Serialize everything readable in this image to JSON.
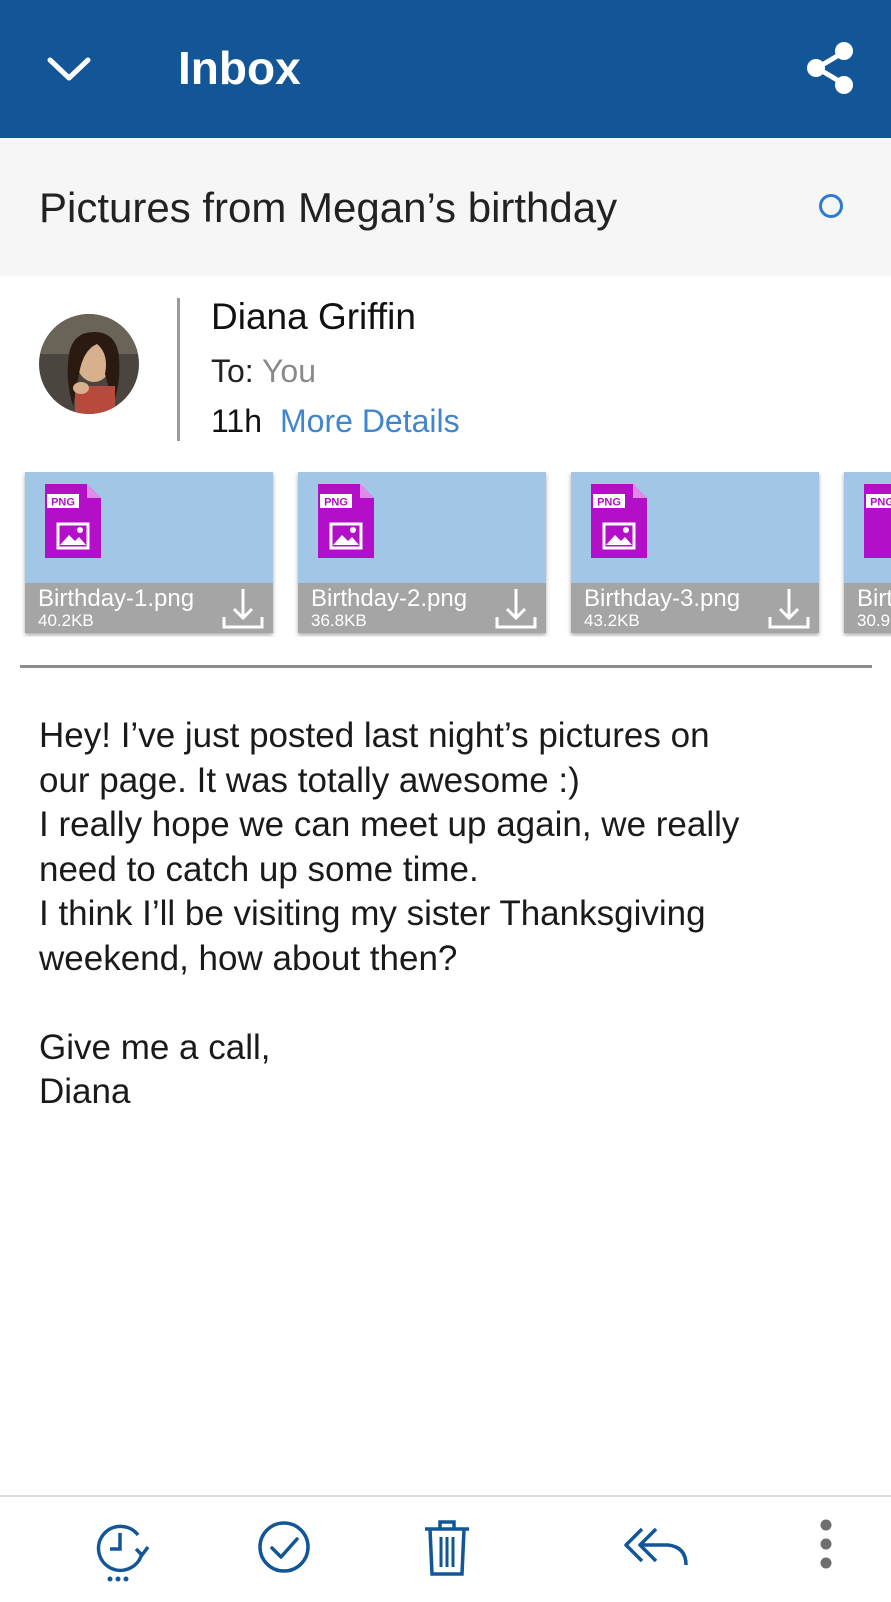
{
  "header": {
    "title": "Inbox",
    "back_icon": "chevron-down-icon",
    "share_icon": "share-icon",
    "bg_color": "#135697"
  },
  "message": {
    "subject": "Pictures from Megan’s birthday",
    "unread_indicator": "circle-outline-icon",
    "sender": "Diana Griffin",
    "to_label": "To:",
    "to_value": "You",
    "time": "11h",
    "more_details": "More Details"
  },
  "attachments": [
    {
      "name": "Birthday-1.png",
      "size": "40.2KB",
      "type_badge": "PNG"
    },
    {
      "name": "Birthday-2.png",
      "size": "36.8KB",
      "type_badge": "PNG"
    },
    {
      "name": "Birthday-3.png",
      "size": "43.2KB",
      "type_badge": "PNG"
    },
    {
      "name": "Birt",
      "size": "30.9",
      "type_badge": "PNG"
    }
  ],
  "body": "Hey! I’ve just posted last night’s pictures on\nour page. It was totally awesome :)\nI really hope we can meet up again, we really\nneed to catch up some time.\nI think I’ll be visiting my sister Thanksgiving\nweekend, how about then?\n\nGive me a call,\nDiana",
  "toolbar": {
    "icons": [
      "snooze-clock-icon",
      "check-circle-icon",
      "trash-icon",
      "reply-all-icon",
      "more-vertical-icon"
    ],
    "accent_color": "#135697"
  }
}
